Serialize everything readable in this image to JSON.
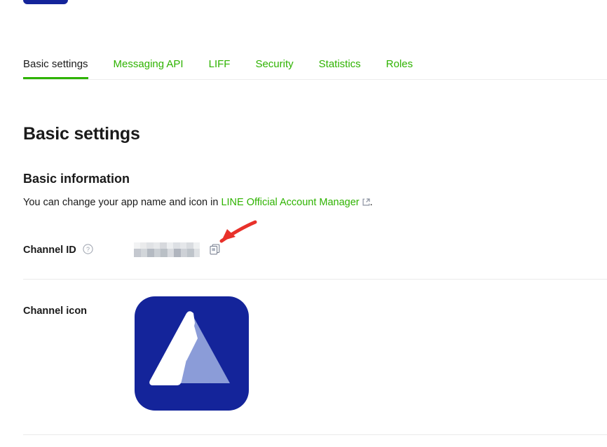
{
  "colors": {
    "accent_green": "#2eb300",
    "text_primary": "#1a1a1a",
    "divider": "#eaeaea",
    "brand_navy": "#14249a",
    "annotation_red": "#e8312a",
    "icon_gray": "#8b92a0"
  },
  "tabs": [
    {
      "label": "Basic settings",
      "active": true
    },
    {
      "label": "Messaging API",
      "active": false
    },
    {
      "label": "LIFF",
      "active": false
    },
    {
      "label": "Security",
      "active": false
    },
    {
      "label": "Statistics",
      "active": false
    },
    {
      "label": "Roles",
      "active": false
    }
  ],
  "page": {
    "title": "Basic settings",
    "section_title": "Basic information",
    "description_prefix": "You can change your app name and icon in ",
    "description_link": "LINE Official Account Manager",
    "description_suffix": "."
  },
  "rows": {
    "channel_id": {
      "label": "Channel ID",
      "value": "",
      "value_state": "redacted",
      "help_icon": "question-circle-icon",
      "copy_icon": "copy-icon"
    },
    "channel_icon": {
      "label": "Channel icon",
      "icon_alt": "channel-app-icon"
    }
  },
  "annotation": {
    "type": "arrow",
    "color": "#e8312a",
    "points_to": "channel-id-value"
  }
}
